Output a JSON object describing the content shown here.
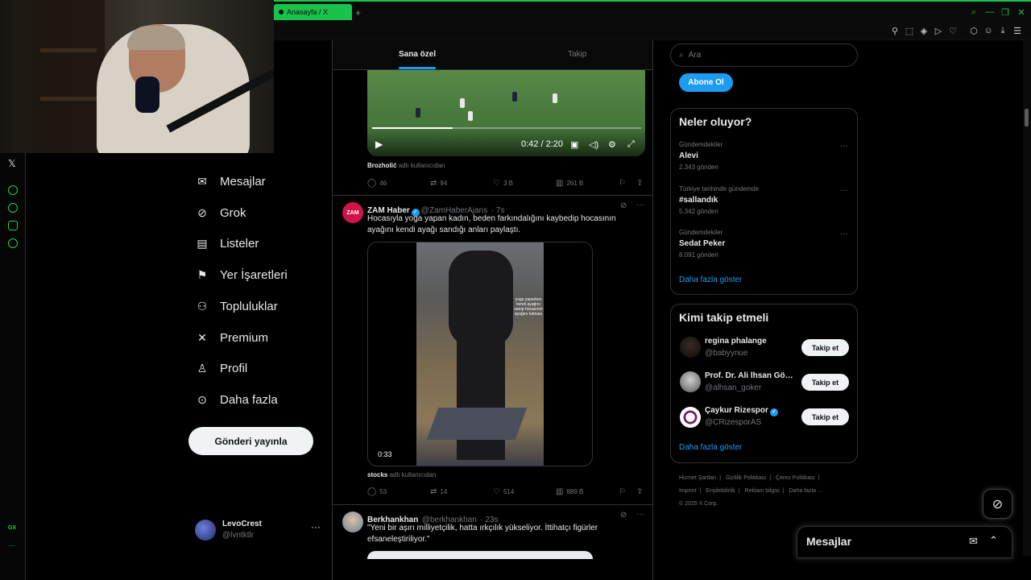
{
  "browser": {
    "tab_title": "Anasayfa / X",
    "new_tab": "+"
  },
  "nav": {
    "items": [
      {
        "label": "Mesajlar"
      },
      {
        "label": "Grok"
      },
      {
        "label": "Listeler"
      },
      {
        "label": "Yer İşaretleri"
      },
      {
        "label": "Topluluklar"
      },
      {
        "label": "Premium"
      },
      {
        "label": "Profil"
      },
      {
        "label": "Daha fazla"
      }
    ],
    "post_button": "Gönderi yayınla",
    "account": {
      "name": "LevoCrest",
      "handle": "@lvntktlr",
      "more": "···"
    }
  },
  "sidebar_strip": {
    "gx_label": "GX",
    "more": "···"
  },
  "feed": {
    "tabs": [
      "Sana özel",
      "Takip"
    ],
    "video1": {
      "time": "0:42 / 2:20"
    },
    "tweet1_footer": {
      "author": "Brozholić",
      "suffix": "adlı kullanıcıdan"
    },
    "tweet1_actions": {
      "replies": "46",
      "reposts": "94",
      "likes": "3 B",
      "views": "261 B"
    },
    "tweet2": {
      "name": "ZAM Haber",
      "handle": "@ZamHaberAjans",
      "time": "· 7s",
      "avatar_text": "ZAM",
      "text": "Hocasıyla yoga yapan kadın, beden farkındalığını kaybedip hocasının ayağını kendi ayağı sandığı anları paylaştı.",
      "video_duration": "0:33",
      "video_caption": "yoga yaparken kendi ayağını sanıp hocasının ayağını tutması"
    },
    "tweet2_footer": {
      "author": "stocks",
      "suffix": "adlı kullanıcıdan"
    },
    "tweet2_actions": {
      "replies": "53",
      "reposts": "14",
      "likes": "514",
      "views": "889 B"
    },
    "tweet3": {
      "name": "Berkhankhan",
      "handle": "@berkhankhan",
      "time": "· 23s",
      "text": "\"Yeni bir aşırı milliyetçilik, hatta ırkçılık yükseliyor. İttihatçı figürler efsaneleştiriliyor.\""
    }
  },
  "right": {
    "search_placeholder": "Ara",
    "subscribe": "Abone Ol",
    "trends": {
      "title": "Neler oluyor?",
      "items": [
        {
          "context": "Gündemdekiler",
          "name": "Alevi",
          "count": "2.343 gönderi"
        },
        {
          "context": "Türkiye tarihinde gündemde",
          "name": "#sallandık",
          "count": "5.342 gönderi"
        },
        {
          "context": "Gündemdekiler",
          "name": "Sedat Peker",
          "count": "8.091 gönderi"
        }
      ],
      "more": "Daha fazla göster"
    },
    "follow": {
      "title": "Kimi takip etmeli",
      "items": [
        {
          "name": "regina phalange",
          "handle": "@babyynue",
          "button": "Takip et"
        },
        {
          "name": "Prof. Dr. Ali İhsan Gökçen",
          "handle": "@alhsan_goker",
          "button": "Takip et"
        },
        {
          "name": "Çaykur Rizespor",
          "handle": "@CRizesporAS",
          "button": "Takip et"
        }
      ],
      "more": "Daha fazla göster"
    },
    "footer": {
      "links": [
        "Hizmet Şartları",
        "Gizlilik Politikası",
        "Çerez Politikası",
        "Imprint",
        "Erişilebilirlik",
        "Reklam bilgisi",
        "Daha fazla ..."
      ],
      "copyright": "© 2025 X Corp."
    }
  },
  "messages_drawer": {
    "title": "Mesajlar"
  },
  "colors": {
    "accent": "#1d9bf0",
    "browser_accent": "#19c24a",
    "background": "#000000"
  }
}
